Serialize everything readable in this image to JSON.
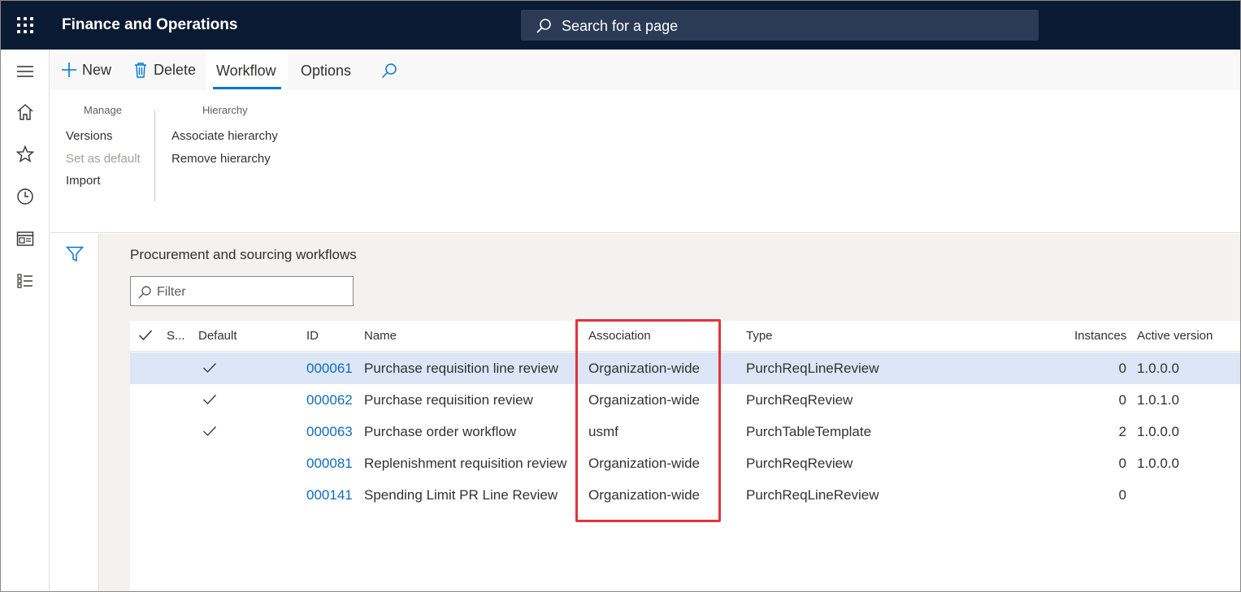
{
  "app": {
    "title": "Finance and Operations"
  },
  "search": {
    "placeholder": "Search for a page"
  },
  "actionpane": {
    "new_label": "New",
    "delete_label": "Delete",
    "tabs": [
      {
        "label": "Workflow",
        "active": true
      },
      {
        "label": "Options",
        "active": false
      }
    ]
  },
  "ribbon": {
    "groups": [
      {
        "title": "Manage",
        "items": [
          {
            "label": "Versions",
            "enabled": true
          },
          {
            "label": "Set as default",
            "enabled": false
          },
          {
            "label": "Import",
            "enabled": true
          }
        ]
      },
      {
        "title": "Hierarchy",
        "items": [
          {
            "label": "Associate hierarchy",
            "enabled": true
          },
          {
            "label": "Remove hierarchy",
            "enabled": true
          }
        ]
      }
    ]
  },
  "content": {
    "title": "Procurement and sourcing workflows",
    "filter_placeholder": "Filter"
  },
  "grid": {
    "columns": [
      "S...",
      "Default",
      "ID",
      "Name",
      "Association",
      "Type",
      "Instances",
      "Active version"
    ],
    "rows": [
      {
        "default": true,
        "id": "000061",
        "name": "Purchase requisition line review",
        "association": "Organization-wide",
        "type": "PurchReqLineReview",
        "instances": "0",
        "active_version": "1.0.0.0",
        "selected": true
      },
      {
        "default": true,
        "id": "000062",
        "name": "Purchase requisition review",
        "association": "Organization-wide",
        "type": "PurchReqReview",
        "instances": "0",
        "active_version": "1.0.1.0",
        "selected": false
      },
      {
        "default": true,
        "id": "000063",
        "name": "Purchase order workflow",
        "association": "usmf",
        "type": "PurchTableTemplate",
        "instances": "2",
        "active_version": "1.0.0.0",
        "selected": false
      },
      {
        "default": false,
        "id": "000081",
        "name": "Replenishment requisition review",
        "association": "Organization-wide",
        "type": "PurchReqReview",
        "instances": "0",
        "active_version": "1.0.0.0",
        "selected": false
      },
      {
        "default": false,
        "id": "000141",
        "name": "Spending Limit PR Line Review",
        "association": "Organization-wide",
        "type": "PurchReqLineReview",
        "instances": "0",
        "active_version": "",
        "selected": false
      }
    ]
  },
  "colors": {
    "topbar": "#0b1a33",
    "accent": "#0078d4",
    "link": "#0f6cbd",
    "highlight": "#e0343a",
    "selected_row": "#dce6f7"
  },
  "icons": [
    "waffle-icon",
    "search-icon",
    "hamburger-icon",
    "home-icon",
    "star-icon",
    "clock-icon",
    "workspace-icon",
    "list-icon",
    "plus-icon",
    "trash-icon",
    "filter-icon",
    "checkmark-icon"
  ]
}
